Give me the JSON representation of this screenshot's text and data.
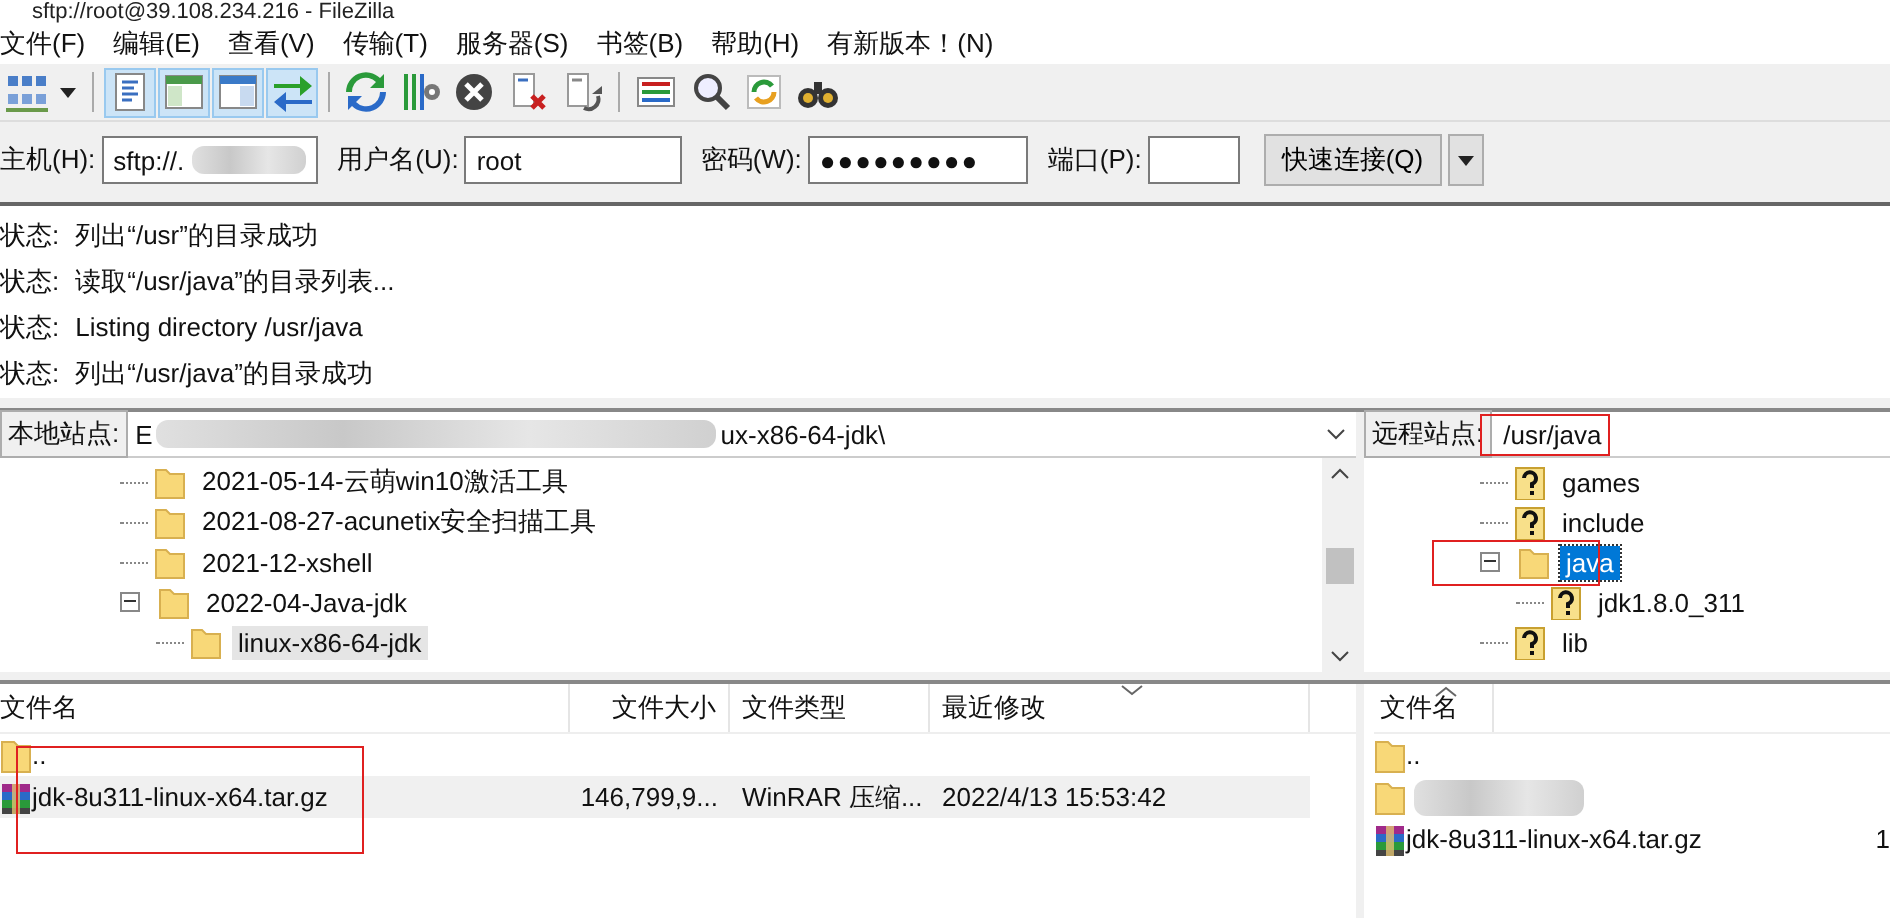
{
  "window": {
    "title": "sftp://root@39.108.234.216 - FileZilla"
  },
  "menu": [
    {
      "label": "文件(F)"
    },
    {
      "label": "编辑(E)"
    },
    {
      "label": "查看(V)"
    },
    {
      "label": "传输(T)"
    },
    {
      "label": "服务器(S)"
    },
    {
      "label": "书签(B)"
    },
    {
      "label": "帮助(H)"
    },
    {
      "label": "有新版本！(N)"
    }
  ],
  "toolbar": [
    {
      "kind": "sites",
      "pressed": false
    },
    {
      "kind": "caret",
      "pressed": false
    },
    {
      "kind": "log",
      "pressed": true
    },
    {
      "kind": "localtree",
      "pressed": true
    },
    {
      "kind": "remotetree",
      "pressed": true
    },
    {
      "kind": "queue",
      "pressed": true
    },
    {
      "kind": "refresh",
      "pressed": false
    },
    {
      "kind": "filters",
      "pressed": false
    },
    {
      "kind": "cancel",
      "pressed": false
    },
    {
      "kind": "disconnect",
      "pressed": false
    },
    {
      "kind": "reconnect",
      "pressed": false
    },
    {
      "kind": "listing",
      "pressed": false
    },
    {
      "kind": "search",
      "pressed": false
    },
    {
      "kind": "sync",
      "pressed": false
    },
    {
      "kind": "find",
      "pressed": false
    }
  ],
  "quickconnect": {
    "host_label": "主机(H):",
    "host": "sftp://.",
    "host_redacted": true,
    "user_label": "用户名(U):",
    "user": "root",
    "password_label": "密码(W):",
    "password": "●●●●●●●●●",
    "port_label": "端口(P):",
    "connect": "快速连接(Q)"
  },
  "log": [
    {
      "prefix": "状态:",
      "text": "列出“/usr”的目录成功"
    },
    {
      "prefix": "状态:",
      "text": "读取“/usr/java”的目录列表..."
    },
    {
      "prefix": "状态:",
      "text": "Listing directory /usr/java"
    },
    {
      "prefix": "状态:",
      "text": "列出“/usr/java”的目录成功"
    }
  ],
  "local_site": {
    "label": "本地站点:",
    "path_start": "E",
    "path_end": "ux-x86-64-jdk\\",
    "redacted": true,
    "tree": [
      {
        "label": "2021-05-14-云萌win10激活工具",
        "selected": false
      },
      {
        "label": "2021-08-27-acunetix安全扫描工具",
        "selected": false
      },
      {
        "label": "2021-12-xshell",
        "selected": false
      },
      {
        "label": "2022-04-Java-jdk",
        "selected": false,
        "expanded": true,
        "children": [
          {
            "label": "linux-x86-64-jdk",
            "selected": true
          }
        ]
      }
    ]
  },
  "remote_site": {
    "label": "远程站点:",
    "path": "/usr/java",
    "highlighted": true,
    "tree": [
      {
        "label": "games",
        "kind": "unknown",
        "selected": false,
        "highlighted": false
      },
      {
        "label": "include",
        "kind": "unknown",
        "selected": false,
        "highlighted": false
      },
      {
        "label": "java",
        "kind": "folder",
        "selected": true,
        "highlighted": true,
        "expanded": true,
        "children": [
          {
            "label": "jdk1.8.0_311",
            "kind": "unknown",
            "selected": false,
            "highlighted": false
          }
        ]
      },
      {
        "label": "lib",
        "kind": "unknown",
        "selected": false,
        "highlighted": false
      }
    ]
  },
  "local_files": {
    "columns": [
      "文件名",
      "文件大小",
      "文件类型",
      "最近修改"
    ],
    "rows": [
      {
        "kind": "folder",
        "cells": [
          ".."
        ],
        "selected": false,
        "highlighted": false
      },
      {
        "kind": "archive",
        "cells": [
          "jdk-8u311-linux-x64.tar.gz",
          "146,799,9...",
          "WinRAR 压缩...",
          "2022/4/13 15:53:42"
        ],
        "selected": true,
        "highlighted": true
      }
    ]
  },
  "remote_files": {
    "columns": [
      "文件名"
    ],
    "rows": [
      {
        "kind": "folder",
        "cells": [
          ".."
        ]
      },
      {
        "kind": "redacted",
        "cells": []
      },
      {
        "kind": "archive",
        "cells": [
          "jdk-8u311-linux-x64.tar.gz",
          "1"
        ]
      }
    ]
  }
}
